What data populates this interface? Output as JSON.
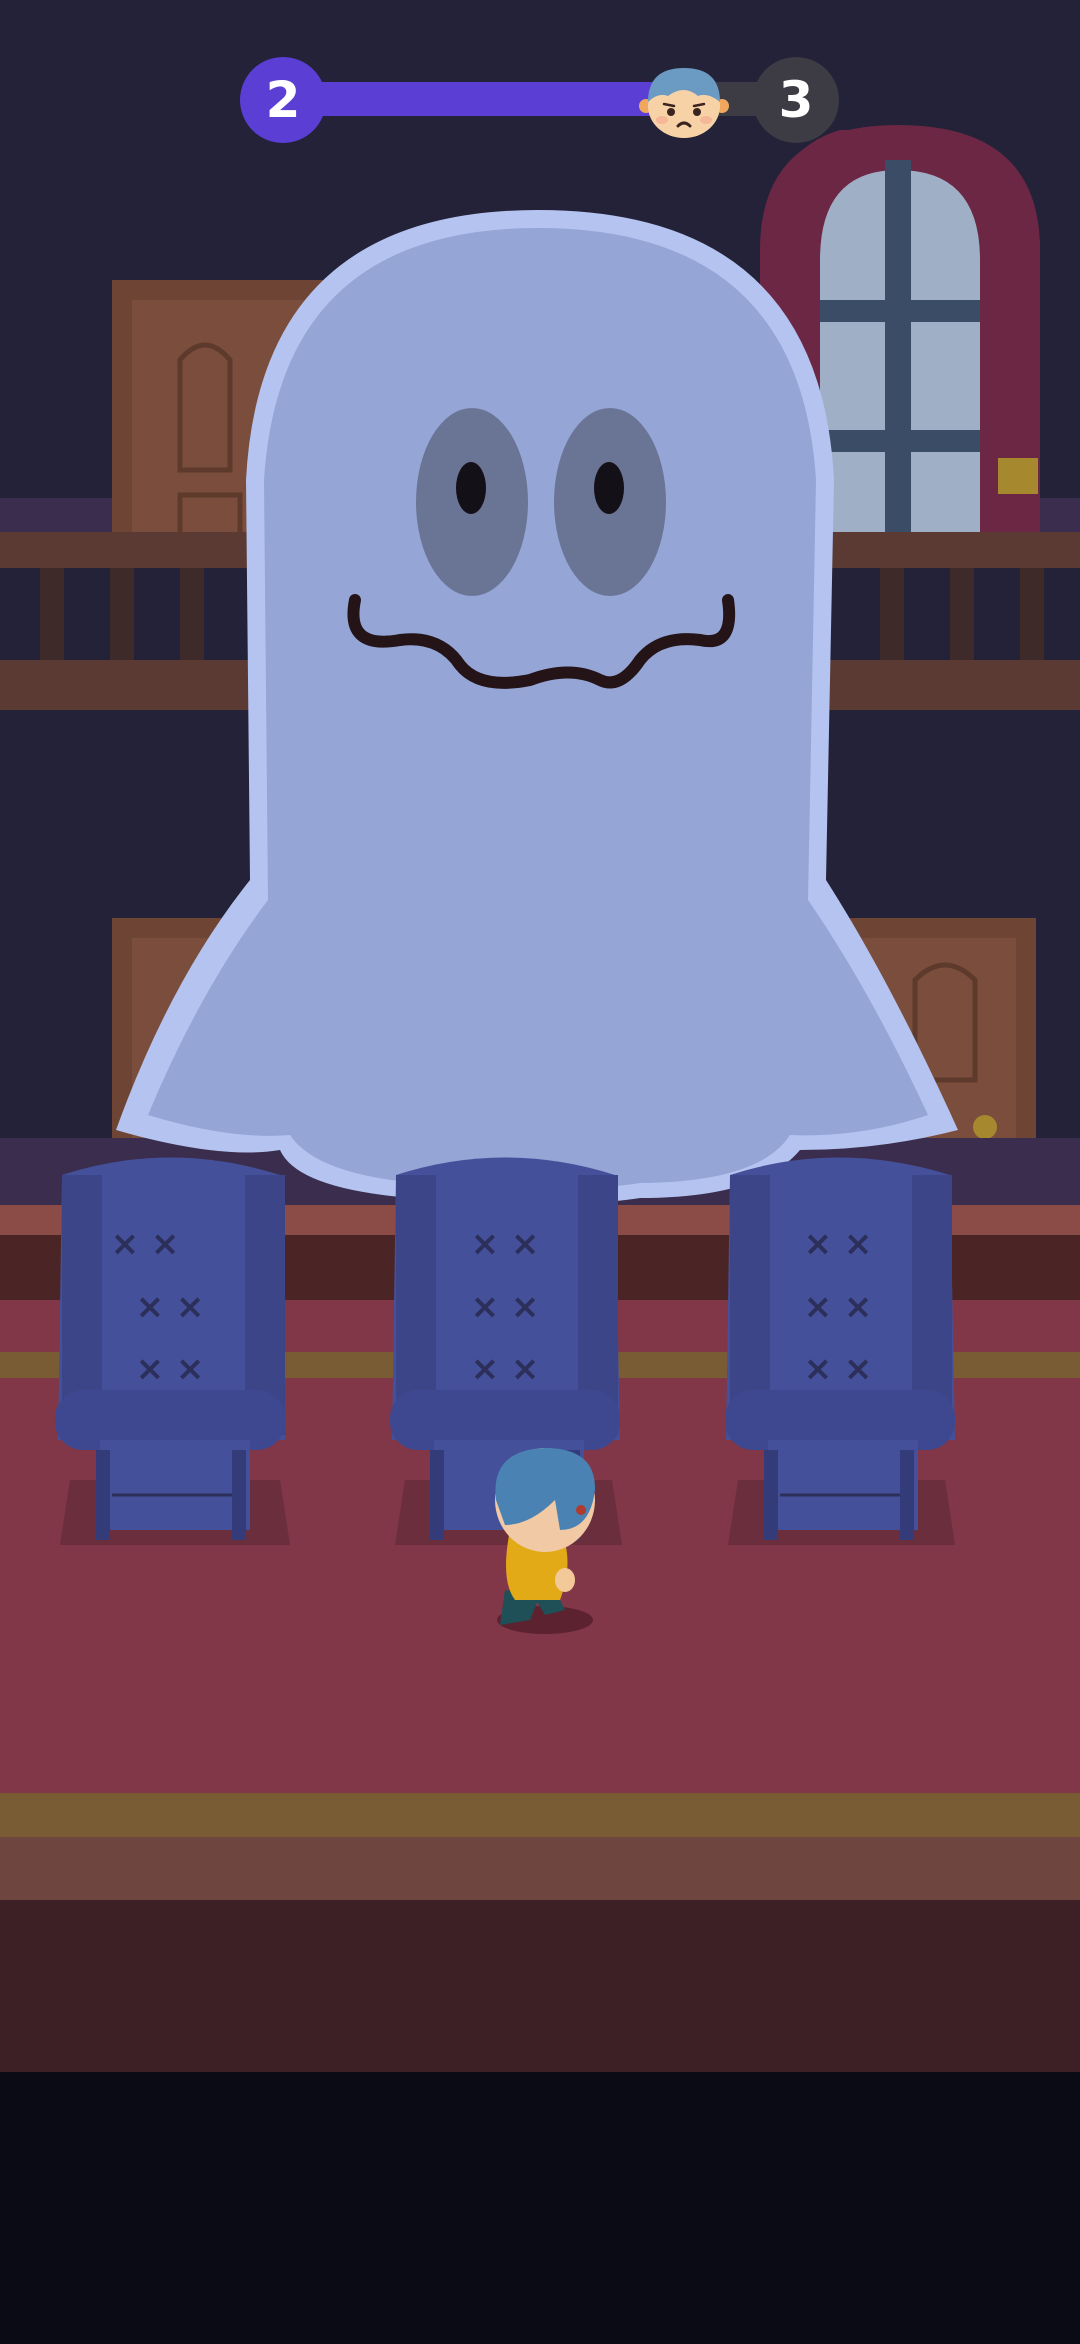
{
  "hud": {
    "level_current": "2",
    "level_next": "3",
    "progress": 0.8,
    "progress_icon": "player-face-icon",
    "colors": {
      "progress_fill": "#5b3fd4",
      "progress_track": "#3d3c44"
    }
  },
  "scene": {
    "enemy": "ghost",
    "player": "blue-haired-child",
    "seats": [
      "armchair",
      "armchair",
      "armchair"
    ],
    "colors": {
      "ghost": "#94a5d6",
      "armchair": "#45509a",
      "carpet": "#813747",
      "wall": "#232238",
      "curtain": "#6b2744"
    }
  }
}
